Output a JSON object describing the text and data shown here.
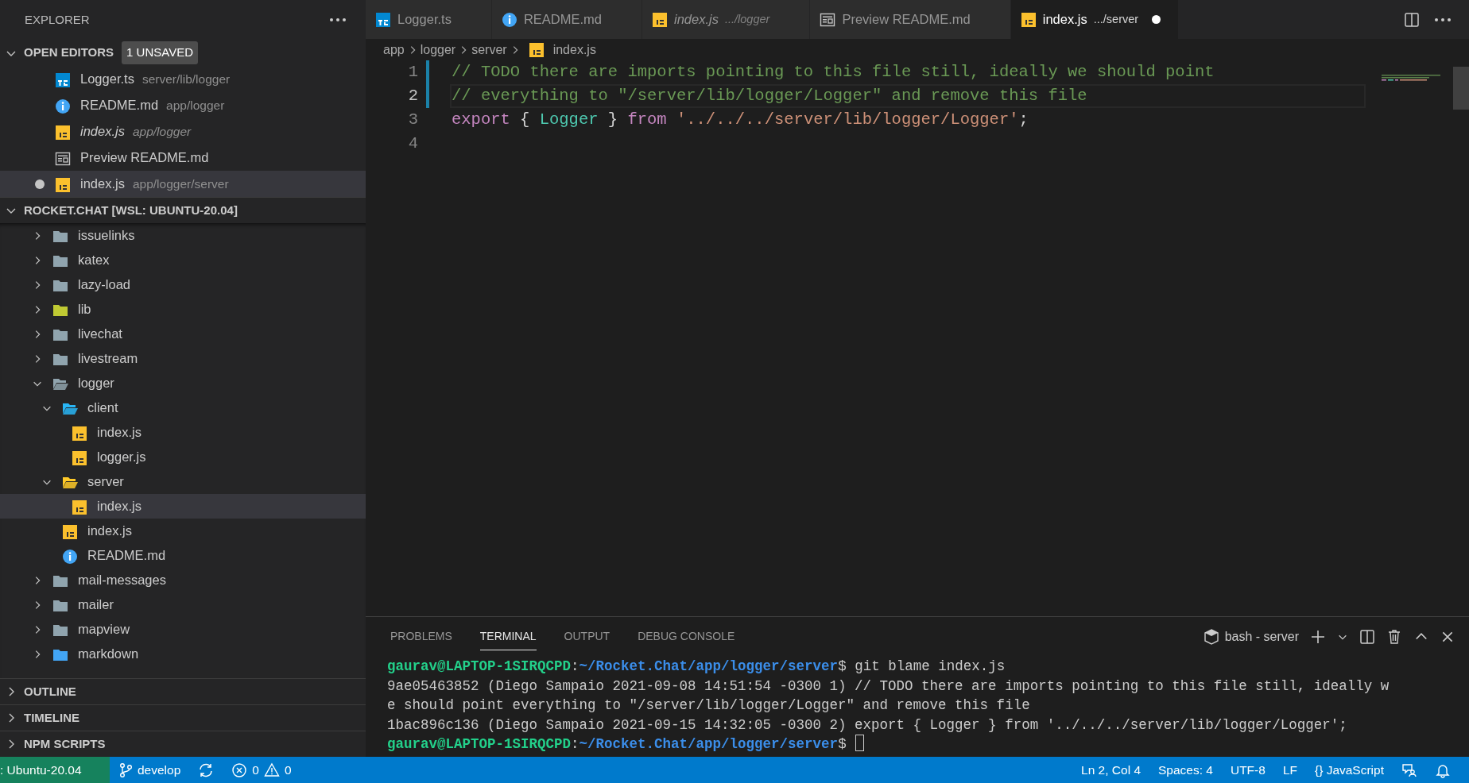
{
  "sidebar": {
    "title": "EXPLORER",
    "open_editors": {
      "title": "OPEN EDITORS",
      "expanded": true,
      "badge": "1 UNSAVED",
      "items": [
        {
          "kind": "ts",
          "name": "Logger.ts",
          "path": "server/lib/logger",
          "preview": false,
          "unsaved": false,
          "selected": false
        },
        {
          "kind": "info",
          "name": "README.md",
          "path": "app/logger",
          "preview": false,
          "unsaved": false,
          "selected": false
        },
        {
          "kind": "js",
          "name": "index.js",
          "path": "app/logger",
          "preview": true,
          "unsaved": false,
          "selected": false
        },
        {
          "kind": "preview",
          "name": "Preview README.md",
          "preview": false,
          "unsaved": false,
          "selected": false
        },
        {
          "kind": "js",
          "name": "index.js",
          "path": "app/logger/server",
          "preview": false,
          "unsaved": true,
          "selected": true
        }
      ]
    },
    "folder": {
      "title": "ROCKET.CHAT [WSL: UBUNTU-20.04]",
      "expanded": true,
      "items": [
        {
          "kind": "folder",
          "label": "issuelinks",
          "expanded": false,
          "selected": false
        },
        {
          "kind": "folder",
          "label": "katex",
          "expanded": false,
          "selected": false
        },
        {
          "kind": "folder",
          "label": "lazy-load",
          "expanded": false,
          "selected": false
        },
        {
          "kind": "libfolder",
          "label": "lib",
          "expanded": false,
          "selected": false
        },
        {
          "kind": "folder",
          "label": "livechat",
          "expanded": false,
          "selected": false
        },
        {
          "kind": "folder",
          "label": "livestream",
          "expanded": false,
          "selected": false
        },
        {
          "kind": "folder",
          "label": "logger",
          "expanded": true,
          "selected": false,
          "children": [
            {
              "kind": "clientfolder",
              "label": "client",
              "expanded": true,
              "selected": false,
              "children": [
                {
                  "kind": "js",
                  "label": "index.js",
                  "selected": false
                },
                {
                  "kind": "js",
                  "label": "logger.js",
                  "selected": false
                }
              ]
            },
            {
              "kind": "serverfolder",
              "label": "server",
              "expanded": true,
              "selected": false,
              "children": [
                {
                  "kind": "js",
                  "label": "index.js",
                  "selected": true
                }
              ]
            },
            {
              "kind": "js",
              "label": "index.js",
              "selected": false
            },
            {
              "kind": "info",
              "label": "README.md",
              "selected": false
            }
          ]
        },
        {
          "kind": "folder",
          "label": "mail-messages",
          "expanded": false,
          "selected": false
        },
        {
          "kind": "folder",
          "label": "mailer",
          "expanded": false,
          "selected": false
        },
        {
          "kind": "folder",
          "label": "mapview",
          "expanded": false,
          "selected": false
        },
        {
          "kind": "markdownfolder",
          "label": "markdown",
          "expanded": false,
          "selected": false
        }
      ]
    },
    "sections": [
      {
        "title": "OUTLINE",
        "expanded": false
      },
      {
        "title": "TIMELINE",
        "expanded": false
      },
      {
        "title": "NPM SCRIPTS",
        "expanded": false
      }
    ]
  },
  "tabs": [
    {
      "kind": "ts",
      "label": "Logger.ts",
      "selected": false,
      "preview": false,
      "unsaved": false
    },
    {
      "kind": "info",
      "label": "README.md",
      "selected": false,
      "preview": false,
      "unsaved": false
    },
    {
      "kind": "js",
      "label": "index.js",
      "description": ".../logger",
      "selected": false,
      "preview": true,
      "unsaved": false
    },
    {
      "kind": "preview",
      "label": "Preview README.md",
      "selected": false,
      "preview": false,
      "unsaved": false
    },
    {
      "kind": "js",
      "label": "index.js",
      "description": ".../server",
      "selected": true,
      "preview": false,
      "unsaved": true
    }
  ],
  "breadcrumb": [
    {
      "text": "app"
    },
    {
      "text": "logger"
    },
    {
      "text": "server"
    },
    {
      "text": "index.js",
      "kind": "js"
    }
  ],
  "editor": {
    "lines": [
      {
        "number": "1",
        "current": false,
        "modified": true,
        "tokens": [
          {
            "kind": "comment",
            "text": "// TODO there are imports pointing to this file still, ideally we should point"
          }
        ]
      },
      {
        "number": "2",
        "current": true,
        "modified": true,
        "tokens": [
          {
            "kind": "comment",
            "text": "// everything to \"/server/lib/logger/Logger\" and remove this file"
          }
        ]
      },
      {
        "number": "3",
        "current": false,
        "modified": false,
        "tokens": [
          {
            "kind": "keyword",
            "text": "export"
          },
          {
            "kind": "punct",
            "text": " { "
          },
          {
            "kind": "type",
            "text": "Logger"
          },
          {
            "kind": "punct",
            "text": " } "
          },
          {
            "kind": "keyword",
            "text": "from "
          },
          {
            "kind": "string",
            "text": "'../../../server/lib/logger/Logger'"
          },
          {
            "kind": "punct",
            "text": ";"
          }
        ]
      },
      {
        "number": "4",
        "current": false,
        "modified": false
      }
    ]
  },
  "panel": {
    "tabs": [
      {
        "label": "PROBLEMS",
        "selected": false
      },
      {
        "label": "TERMINAL",
        "selected": true
      },
      {
        "label": "OUTPUT",
        "selected": false
      },
      {
        "label": "DEBUG CONSOLE",
        "selected": false
      }
    ],
    "terminal_name": "bash - server",
    "lines": [
      {
        "segments": [
          {
            "kind": "user",
            "text": "gaurav@LAPTOP-1SIRQCPD"
          },
          {
            "kind": "plain",
            "text": ":"
          },
          {
            "kind": "path",
            "text": "~/Rocket.Chat/app/logger/server"
          },
          {
            "kind": "plain",
            "text": "$ git blame index.js"
          }
        ]
      },
      {
        "segments": [
          {
            "kind": "plain",
            "text": "9ae05463852 (Diego Sampaio 2021-09-08 14:51:54 -0300 1) // TODO there are imports pointing to this file still, ideally w"
          }
        ]
      },
      {
        "segments": [
          {
            "kind": "plain",
            "text": "e should point everything to \"/server/lib/logger/Logger\" and remove this file"
          }
        ]
      },
      {
        "segments": [
          {
            "kind": "plain",
            "text": "1bac896c136 (Diego Sampaio 2021-09-15 14:32:05 -0300 2) export { Logger } from '../../../server/lib/logger/Logger';"
          }
        ]
      },
      {
        "segments": [
          {
            "kind": "user",
            "text": "gaurav@LAPTOP-1SIRQCPD"
          },
          {
            "kind": "plain",
            "text": ":"
          },
          {
            "kind": "path",
            "text": "~/Rocket.Chat/app/logger/server"
          },
          {
            "kind": "plain",
            "text": "$"
          }
        ],
        "cursor": true
      }
    ]
  },
  "status_bar": {
    "left": [
      {
        "kind": "remote",
        "text": ": Ubuntu-20.04"
      },
      {
        "kind": "branch",
        "text": "develop"
      },
      {
        "kind": "sync"
      },
      {
        "kind": "problems",
        "errors": "0",
        "warnings": "0"
      }
    ],
    "right": [
      {
        "kind": "text",
        "text": "Ln 2, Col 4"
      },
      {
        "kind": "text",
        "text": "Spaces: 4"
      },
      {
        "kind": "text",
        "text": "UTF-8"
      },
      {
        "kind": "text",
        "text": "LF"
      },
      {
        "kind": "language",
        "icon_text": "{}",
        "text": "JavaScript"
      },
      {
        "kind": "feedback"
      },
      {
        "kind": "bell"
      }
    ]
  }
}
